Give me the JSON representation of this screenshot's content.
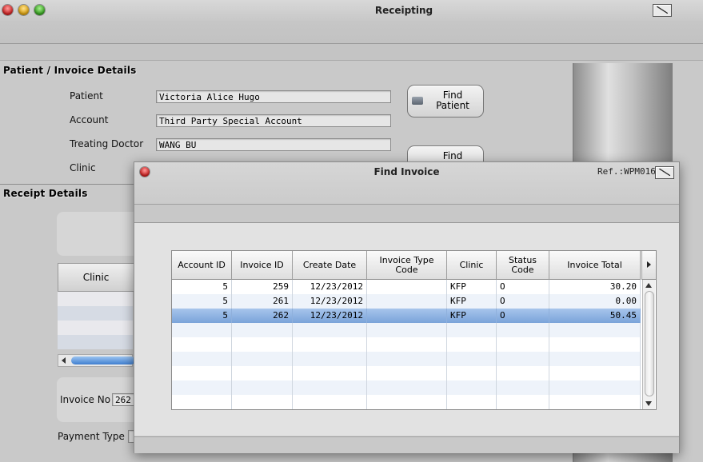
{
  "window": {
    "title": "Receipting"
  },
  "patient_section": {
    "title": "Patient / Invoice Details",
    "patient_label": "Patient",
    "patient_value": "Victoria Alice Hugo",
    "account_label": "Account",
    "account_value": "Third Party Special Account",
    "doctor_label": "Treating Doctor",
    "doctor_value": "WANG BU",
    "clinic_label": "Clinic",
    "find_patient_label_1": "Find",
    "find_patient_label_2": "Patient",
    "find_clinic_label": "Find"
  },
  "receipt_section": {
    "title": "Receipt Details",
    "clinic_col": "Clinic",
    "invoice_no_label": "Invoice No",
    "invoice_no_value": "262",
    "payment_type_label": "Payment Type"
  },
  "dialog": {
    "title": "Find Invoice",
    "ref": "Ref.:WPM016",
    "columns": [
      {
        "line1": "Account ID",
        "line2": ""
      },
      {
        "line1": "Invoice ID",
        "line2": ""
      },
      {
        "line1": "Create Date",
        "line2": ""
      },
      {
        "line1": "Invoice Type",
        "line2": "Code"
      },
      {
        "line1": "Clinic",
        "line2": ""
      },
      {
        "line1": "Status",
        "line2": "Code"
      },
      {
        "line1": "Invoice Total",
        "line2": ""
      }
    ],
    "rows": [
      {
        "account_id": "5",
        "invoice_id": "259",
        "create_date": "12/23/2012",
        "type_code": "",
        "clinic": "KFP",
        "status": "O",
        "total": "30.20",
        "selected": false
      },
      {
        "account_id": "5",
        "invoice_id": "261",
        "create_date": "12/23/2012",
        "type_code": "",
        "clinic": "KFP",
        "status": "O",
        "total": "0.00",
        "selected": false
      },
      {
        "account_id": "5",
        "invoice_id": "262",
        "create_date": "12/23/2012",
        "type_code": "",
        "clinic": "KFP",
        "status": "O",
        "total": "50.45",
        "selected": true
      }
    ],
    "empty_rows": 6
  }
}
